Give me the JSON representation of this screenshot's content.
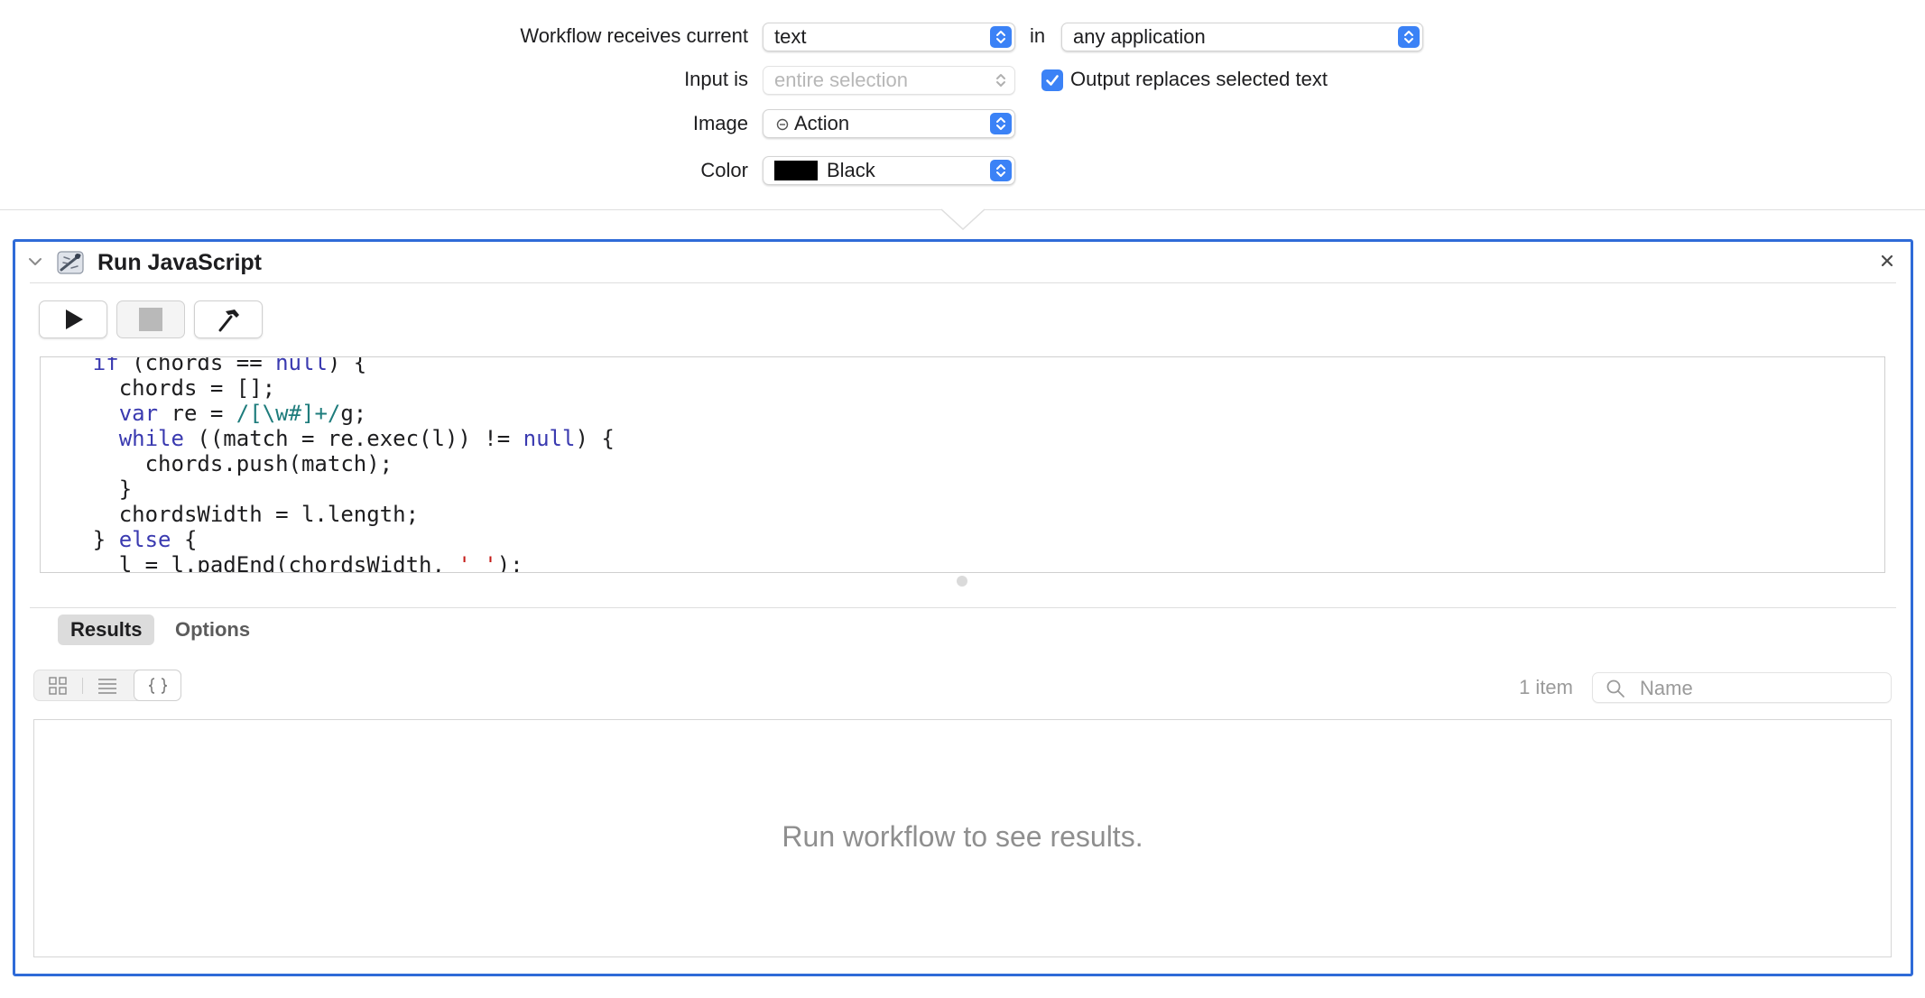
{
  "settings": {
    "receives_label": "Workflow receives current",
    "receives_value": "text",
    "in_label": "in",
    "app_value": "any application",
    "input_label": "Input is",
    "input_value": "entire selection",
    "output_replaces_label": "Output replaces selected text",
    "output_replaces_checked": true,
    "image_label": "Image",
    "image_value": "Action",
    "color_label": "Color",
    "color_value": "Black",
    "color_swatch": "#000000"
  },
  "action": {
    "title": "Run JavaScript",
    "icon": "script-editor-icon",
    "close_icon": "close-icon",
    "toolbar": [
      "run-icon",
      "stop-icon",
      "compile-hammer-icon"
    ]
  },
  "code": {
    "lines": [
      [
        {
          "t": "    "
        },
        {
          "t": "if",
          "c": "kw"
        },
        {
          "t": " (chords == "
        },
        {
          "t": "null",
          "c": "kw"
        },
        {
          "t": ") {"
        }
      ],
      [
        {
          "t": "      chords = [];"
        }
      ],
      [
        {
          "t": "      "
        },
        {
          "t": "var",
          "c": "kw"
        },
        {
          "t": " re = "
        },
        {
          "t": "/[\\w#]+/",
          "c": "re"
        },
        {
          "t": "g;"
        }
      ],
      [
        {
          "t": "      "
        },
        {
          "t": "while",
          "c": "kw"
        },
        {
          "t": " ((match = re.exec(l)) != "
        },
        {
          "t": "null",
          "c": "kw"
        },
        {
          "t": ") {"
        }
      ],
      [
        {
          "t": "        chords.push(match);"
        }
      ],
      [
        {
          "t": "      }"
        }
      ],
      [
        {
          "t": "      chordsWidth = l.length;"
        }
      ],
      [
        {
          "t": "    } "
        },
        {
          "t": "else",
          "c": "kw"
        },
        {
          "t": " {"
        }
      ],
      [
        {
          "t": "      l = l.padEnd(chordsWidth, "
        },
        {
          "t": "' '",
          "c": "str"
        },
        {
          "t": ");"
        }
      ]
    ]
  },
  "tabs": [
    {
      "label": "Results",
      "active": true
    },
    {
      "label": "Options",
      "active": false
    }
  ],
  "results": {
    "view_modes": [
      "icon-grid-icon",
      "list-icon",
      "json-braces-icon"
    ],
    "count": "1 item",
    "search_placeholder": "Name",
    "empty_message": "Run workflow to see results."
  },
  "colors": {
    "accent": "#3b82f6",
    "selection_border": "#2f6bd8"
  }
}
